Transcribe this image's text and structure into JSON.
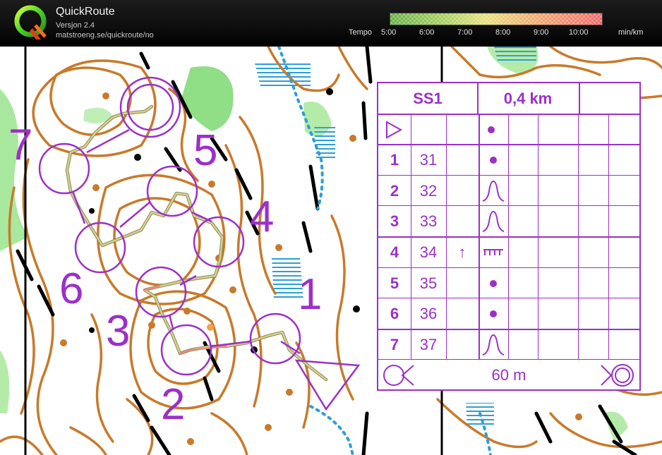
{
  "app": {
    "name": "QuickRoute",
    "version": "Versjon 2.4",
    "url": "matstroeng.se/quickroute/no"
  },
  "tempo": {
    "label": "Tempo",
    "ticks": [
      "5:00",
      "6:00",
      "7:00",
      "8:00",
      "9:00",
      "10:00"
    ],
    "unit": "min/km"
  },
  "colors": {
    "course": "#9b30c8",
    "contour": "#c87a2a",
    "vegetation": "#7dd870",
    "water": "#2b9fd8",
    "route": "#c8c26a"
  },
  "map": {
    "control_labels": [
      "1",
      "2",
      "3",
      "4",
      "5",
      "6",
      "7"
    ]
  },
  "description": {
    "course": "SS1",
    "length": "0,4 km",
    "start_symbol": "start-triangle-icon",
    "rows": [
      {
        "num": "1",
        "code": "31",
        "dir": "",
        "feature": "dot-icon"
      },
      {
        "num": "2",
        "code": "32",
        "dir": "",
        "feature": "knoll-icon"
      },
      {
        "num": "3",
        "code": "33",
        "dir": "",
        "feature": "knoll-icon"
      },
      {
        "num": "4",
        "code": "34",
        "dir": "↑",
        "feature": "earth-bank-icon"
      },
      {
        "num": "5",
        "code": "35",
        "dir": "",
        "feature": "dot-icon"
      },
      {
        "num": "6",
        "code": "36",
        "dir": "",
        "feature": "dot-icon"
      },
      {
        "num": "7",
        "code": "37",
        "dir": "",
        "feature": "knoll-icon"
      }
    ],
    "finish_distance": "60 m"
  }
}
